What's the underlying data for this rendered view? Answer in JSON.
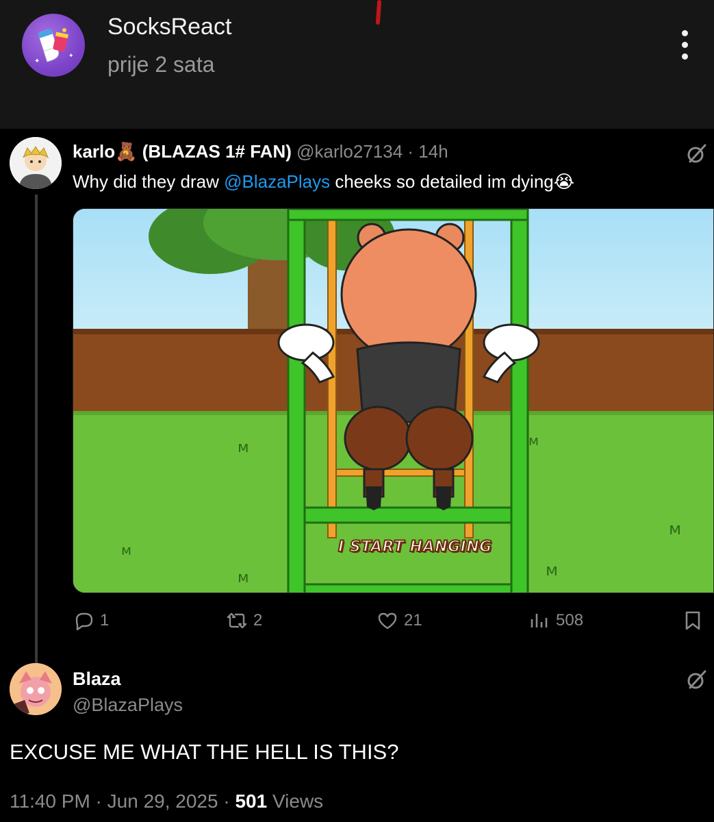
{
  "post": {
    "channel_name": "SocksReact",
    "time": "prije 2 sata",
    "menu_icon": "more-vertical-icon"
  },
  "tweet1": {
    "name": "karlo",
    "name_emoji": "🧸",
    "name_suffix": "(BLAZAS 1# FAN)",
    "handle": "@karlo27134",
    "sep": " · ",
    "age": "14h",
    "text_before": "Why did they draw ",
    "mention": "@BlazaPlays",
    "text_after": " cheeks so detailed im dying",
    "text_emoji": "😭",
    "media_caption": "I START HANGING",
    "replies": "1",
    "reposts": "2",
    "likes": "21",
    "views": "508"
  },
  "tweet2": {
    "name": "Blaza",
    "handle": "@BlazaPlays",
    "text": "EXCUSE ME WHAT THE HELL IS THIS?",
    "time": "11:40 PM",
    "sep": " · ",
    "date": "Jun 29, 2025",
    "views_count": "501",
    "views_label": "Views"
  },
  "colors": {
    "mention": "#1d9bf0",
    "header_bg": "#161616",
    "background": "#000000"
  }
}
